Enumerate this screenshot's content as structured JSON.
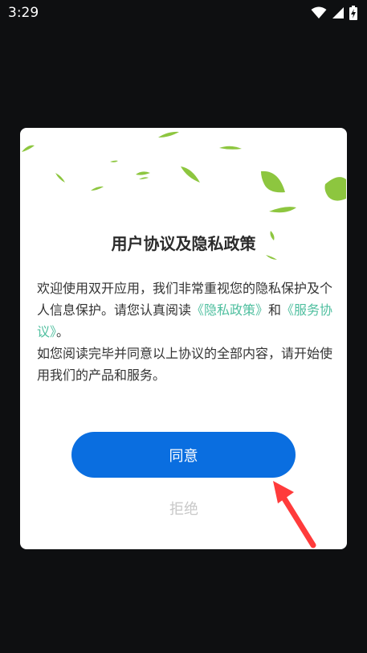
{
  "status_bar": {
    "time": "3:29",
    "icons": [
      "wifi-icon",
      "cellular-signal-icon",
      "battery-charging-icon"
    ]
  },
  "dialog": {
    "title": "用户协议及隐私政策",
    "body": {
      "part1": "欢迎使用双开应用，我们非常重视您的隐私保护及个人信息保护。请您认真阅读",
      "privacy_link": "《隐私政策》",
      "connector": "和",
      "service_link": "《服务协议》",
      "part2": "。",
      "part3": "如您阅读完毕并同意以上协议的全部内容，请开始使用我们的产品和服务。"
    },
    "agree_label": "同意",
    "decline_label": "拒绝"
  },
  "colors": {
    "primary": "#0a6ee0",
    "link": "#4fbf9f",
    "leaf": "#7cc242",
    "arrow": "#ff3b3b"
  }
}
